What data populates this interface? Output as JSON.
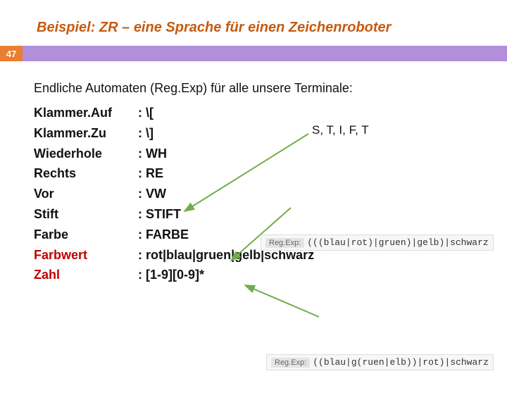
{
  "title": "Beispiel:  ZR – eine Sprache für einen Zeichenroboter",
  "slideNumber": "47",
  "intro": "Endliche Automaten (Reg.Exp) für alle unsere Terminale:",
  "rows": [
    {
      "term": "Klammer.Auf",
      "def": ": \\["
    },
    {
      "term": "Klammer.Zu",
      "def": ": \\]"
    },
    {
      "term": "Wiederhole",
      "def": ": WH"
    },
    {
      "term": "Rechts",
      "def": ": RE"
    },
    {
      "term": "Vor",
      "def": ": VW"
    },
    {
      "term": "Stift",
      "def": ": STIFT"
    },
    {
      "term": "Farbe",
      "def": ": FARBE"
    },
    {
      "term": "Farbwert",
      "def": ": rot|blau|gruen|gelb|schwarz"
    },
    {
      "term": "Zahl",
      "def": ": [1-9][0-9]*"
    }
  ],
  "annotation": "S, T, I, F, T",
  "regex1": "(((blau|rot)|gruen)|gelb)|schwarz",
  "regex2": "((blau|g(ruen|elb))|rot)|schwarz",
  "regLabel": "Reg.Exp:"
}
